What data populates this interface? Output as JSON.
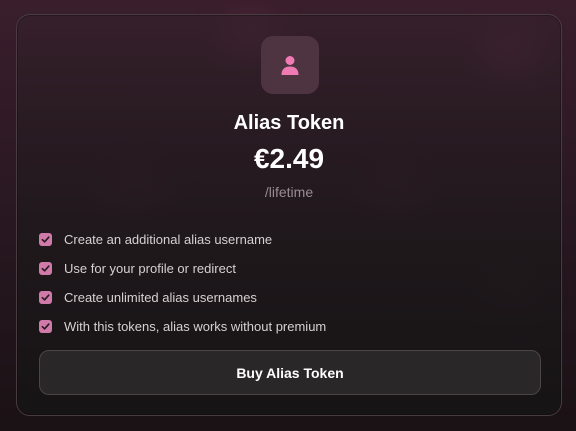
{
  "card": {
    "icon": "user-icon",
    "title": "Alias Token",
    "price": "€2.49",
    "period": "/lifetime",
    "features": [
      "Create an additional alias username",
      "Use for your profile or redirect",
      "Create unlimited alias usernames",
      "With this tokens, alias works without premium"
    ],
    "button_label": "Buy Alias Token"
  },
  "colors": {
    "accent": "#f07ab4",
    "check": "#cf7aa8",
    "card_border": "#4a3a42"
  }
}
